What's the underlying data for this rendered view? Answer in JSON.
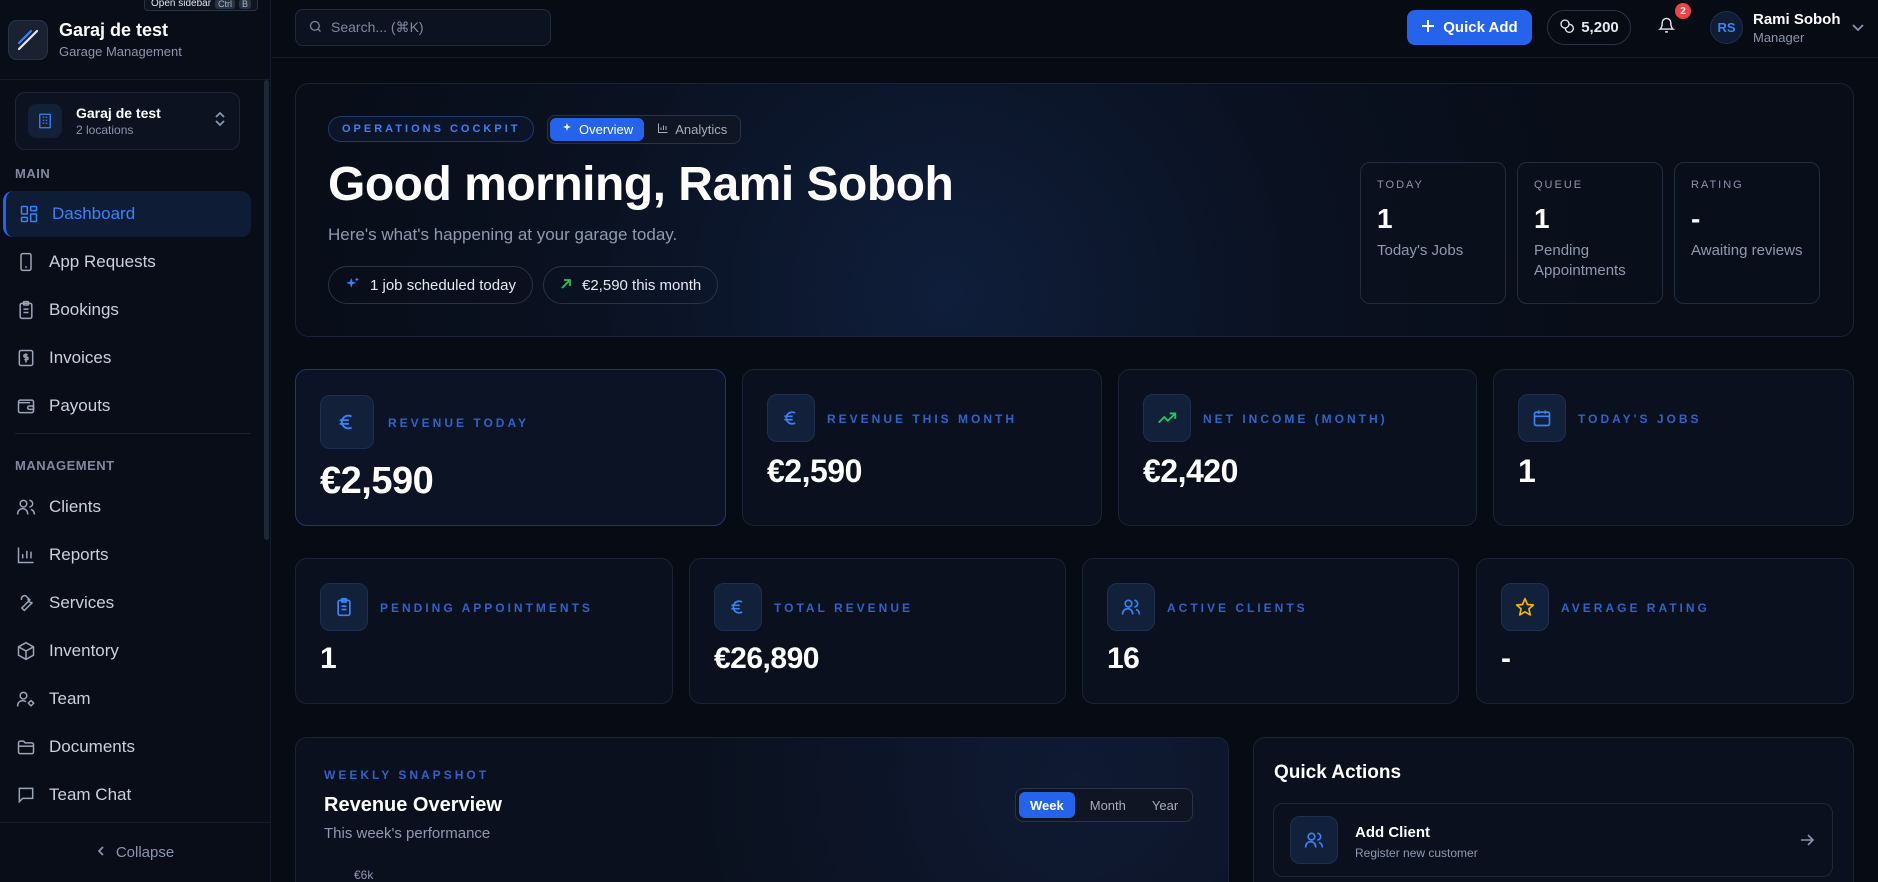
{
  "brand": {
    "name": "Garaj de test",
    "subtitle": "Garage Management",
    "tooltip": "Open sidebar",
    "shortcut_keys": [
      "Ctrl",
      "B"
    ]
  },
  "location": {
    "name": "Garaj de test",
    "count": "2 locations"
  },
  "sidebar": {
    "main_label": "MAIN",
    "main_items": [
      {
        "label": "Dashboard",
        "icon": "dashboard-icon",
        "active": true
      },
      {
        "label": "App Requests",
        "icon": "phone-icon"
      },
      {
        "label": "Bookings",
        "icon": "clipboard-icon"
      },
      {
        "label": "Invoices",
        "icon": "dollar-icon"
      },
      {
        "label": "Payouts",
        "icon": "wallet-icon"
      }
    ],
    "management_label": "MANAGEMENT",
    "management_items": [
      {
        "label": "Clients",
        "icon": "users-icon"
      },
      {
        "label": "Reports",
        "icon": "bar-chart-icon"
      },
      {
        "label": "Services",
        "icon": "wrench-icon"
      },
      {
        "label": "Inventory",
        "icon": "box-icon"
      },
      {
        "label": "Team",
        "icon": "user-cog-icon"
      },
      {
        "label": "Documents",
        "icon": "folder-icon"
      },
      {
        "label": "Team Chat",
        "icon": "chat-icon"
      }
    ],
    "collapse_label": "Collapse"
  },
  "topbar": {
    "search_placeholder": "Search... (⌘K)",
    "quick_add_label": "Quick Add",
    "credits": "5,200",
    "notifications_count": "2",
    "user_initials": "RS",
    "user_name": "Rami Soboh",
    "user_role": "Manager"
  },
  "hero": {
    "eyebrow": "OPERATIONS COCKPIT",
    "tabs": [
      {
        "label": "Overview",
        "active": true
      },
      {
        "label": "Analytics",
        "active": false
      }
    ],
    "greeting": "Good morning, Rami Soboh",
    "subtitle": "Here's what's happening at your garage today.",
    "chips": [
      "1 job scheduled today",
      "€2,590 this month"
    ],
    "minis": [
      {
        "label": "TODAY",
        "value": "1",
        "desc": "Today's Jobs"
      },
      {
        "label": "QUEUE",
        "value": "1",
        "desc": "Pending Appointments"
      },
      {
        "label": "RATING",
        "value": "-",
        "desc": "Awaiting reviews"
      }
    ]
  },
  "stats_row1": [
    {
      "label": "REVENUE TODAY",
      "value": "€2,590",
      "icon": "euro-icon"
    },
    {
      "label": "REVENUE THIS MONTH",
      "value": "€2,590",
      "icon": "euro-icon"
    },
    {
      "label": "NET INCOME (MONTH)",
      "value": "€2,420",
      "icon": "trending-up-icon"
    },
    {
      "label": "TODAY'S JOBS",
      "value": "1",
      "icon": "calendar-icon"
    }
  ],
  "stats_row2": [
    {
      "label": "PENDING APPOINTMENTS",
      "value": "1",
      "icon": "clipboard-icon"
    },
    {
      "label": "TOTAL REVENUE",
      "value": "€26,890",
      "icon": "euro-icon"
    },
    {
      "label": "ACTIVE CLIENTS",
      "value": "16",
      "icon": "users-icon"
    },
    {
      "label": "AVERAGE RATING",
      "value": "-",
      "icon": "star-icon"
    }
  ],
  "revenue": {
    "eyebrow": "WEEKLY SNAPSHOT",
    "title": "Revenue Overview",
    "subtitle": "This week's performance",
    "ranges": [
      {
        "label": "Week",
        "active": true
      },
      {
        "label": "Month"
      },
      {
        "label": "Year"
      }
    ],
    "y_tick_top": "€6k"
  },
  "quick_actions": {
    "title": "Quick Actions",
    "items": [
      {
        "name": "Add Client",
        "desc": "Register new customer",
        "icon": "users-icon"
      }
    ]
  },
  "colors": {
    "accent": "#2563eb",
    "accent_text": "#3b82f6",
    "background": "#070b14",
    "badge": "#ef4444",
    "positive": "#22c55e",
    "rating": "#f5b400"
  }
}
